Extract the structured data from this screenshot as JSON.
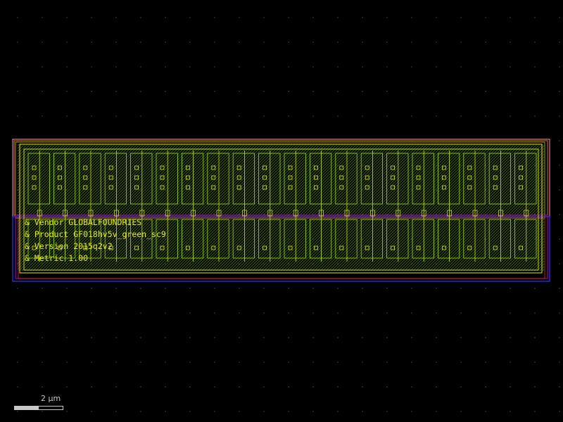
{
  "layout_view": {
    "background": "#000000",
    "grid_dot_color": "#444444",
    "layers": {
      "comp": "#ff8cb4",
      "pplus": "#d07828",
      "nwell": "#b0a000",
      "dualgate": "#c000c0",
      "metal1": "#3333ff",
      "poly": "#e03030",
      "active": "#70c000",
      "fill": "#8fdc00"
    },
    "cell_count": 20
  },
  "text_labels": [
    "& Vendor GLOBALFOUNDRIES",
    "& Product GF018hv5v_green_sc9",
    "& Version 2015q2v2",
    "& Metric 1.00"
  ],
  "scale_bar": {
    "label": "2 μm"
  }
}
